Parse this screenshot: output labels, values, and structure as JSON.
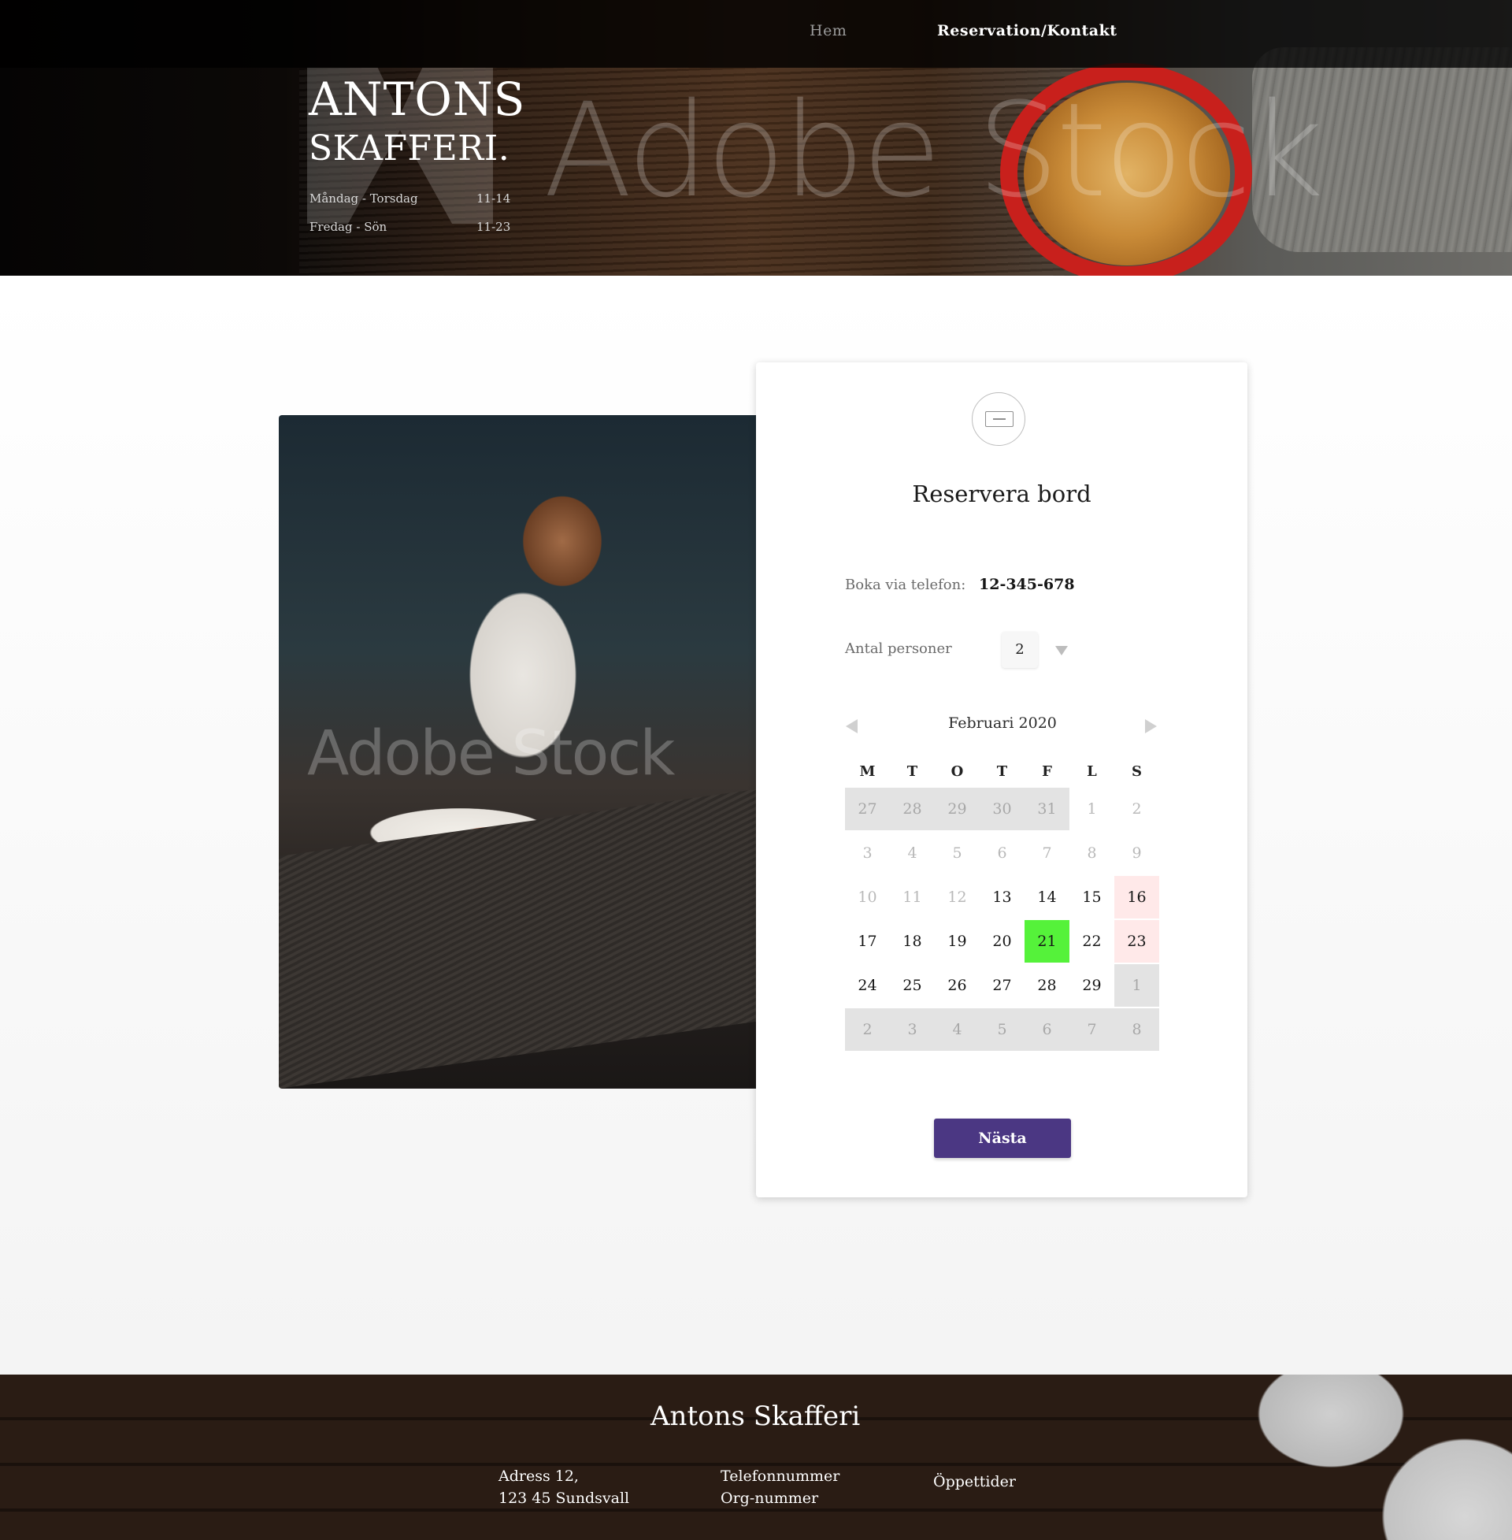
{
  "nav": {
    "home_label": "Hem",
    "reservation_label": "Reservation/Kontakt"
  },
  "hero": {
    "brand_line1": "ANTONS",
    "brand_line2": "SKAFFERI.",
    "watermark": "Adobe Stock",
    "hours": [
      {
        "days": "Måndag - Torsdag",
        "time": "11-14"
      },
      {
        "days": "Fredag - Sön",
        "time": "11-23"
      }
    ]
  },
  "photo": {
    "watermark": "Adobe Stock"
  },
  "booking": {
    "icon": "ticket-icon",
    "title": "Reservera bord",
    "phone_label": "Boka via telefon:",
    "phone_number": "12-345-678",
    "guests_label": "Antal personer",
    "guests_value": "2",
    "month_label": "Februari 2020",
    "weekdays": [
      "M",
      "T",
      "O",
      "T",
      "F",
      "L",
      "S"
    ],
    "weeks": [
      [
        {
          "d": "27",
          "s": "other"
        },
        {
          "d": "28",
          "s": "other"
        },
        {
          "d": "29",
          "s": "other"
        },
        {
          "d": "30",
          "s": "other"
        },
        {
          "d": "31",
          "s": "other"
        },
        {
          "d": "1",
          "s": "muted"
        },
        {
          "d": "2",
          "s": "muted"
        }
      ],
      [
        {
          "d": "3",
          "s": "muted"
        },
        {
          "d": "4",
          "s": "muted"
        },
        {
          "d": "5",
          "s": "muted"
        },
        {
          "d": "6",
          "s": "muted"
        },
        {
          "d": "7",
          "s": "muted"
        },
        {
          "d": "8",
          "s": "muted"
        },
        {
          "d": "9",
          "s": "muted"
        }
      ],
      [
        {
          "d": "10",
          "s": "muted"
        },
        {
          "d": "11",
          "s": "muted"
        },
        {
          "d": "12",
          "s": "muted"
        },
        {
          "d": "13",
          "s": "available"
        },
        {
          "d": "14",
          "s": "available"
        },
        {
          "d": "15",
          "s": "available"
        },
        {
          "d": "16",
          "s": "weekend"
        }
      ],
      [
        {
          "d": "17",
          "s": "available"
        },
        {
          "d": "18",
          "s": "available"
        },
        {
          "d": "19",
          "s": "available"
        },
        {
          "d": "20",
          "s": "available"
        },
        {
          "d": "21",
          "s": "selected"
        },
        {
          "d": "22",
          "s": "available"
        },
        {
          "d": "23",
          "s": "weekend"
        }
      ],
      [
        {
          "d": "24",
          "s": "available"
        },
        {
          "d": "25",
          "s": "available"
        },
        {
          "d": "26",
          "s": "available"
        },
        {
          "d": "27",
          "s": "available"
        },
        {
          "d": "28",
          "s": "available"
        },
        {
          "d": "29",
          "s": "available"
        },
        {
          "d": "1",
          "s": "other"
        }
      ],
      [
        {
          "d": "2",
          "s": "other"
        },
        {
          "d": "3",
          "s": "other"
        },
        {
          "d": "4",
          "s": "other"
        },
        {
          "d": "5",
          "s": "other"
        },
        {
          "d": "6",
          "s": "other"
        },
        {
          "d": "7",
          "s": "other"
        },
        {
          "d": "8",
          "s": "other"
        }
      ]
    ],
    "next_label": "Nästa",
    "colors": {
      "selected": "#55f23a",
      "weekend": "#ffe9e9",
      "other_month": "#e3e3e3",
      "button": "#4b3783"
    }
  },
  "footer": {
    "title": "Antons Skafferi",
    "address_line1": "Adress 12,",
    "address_line2": "123 45 Sundsvall",
    "phone_line": "Telefonnummer",
    "org_line": "Org-nummer",
    "hours_link": "Öppettider"
  }
}
